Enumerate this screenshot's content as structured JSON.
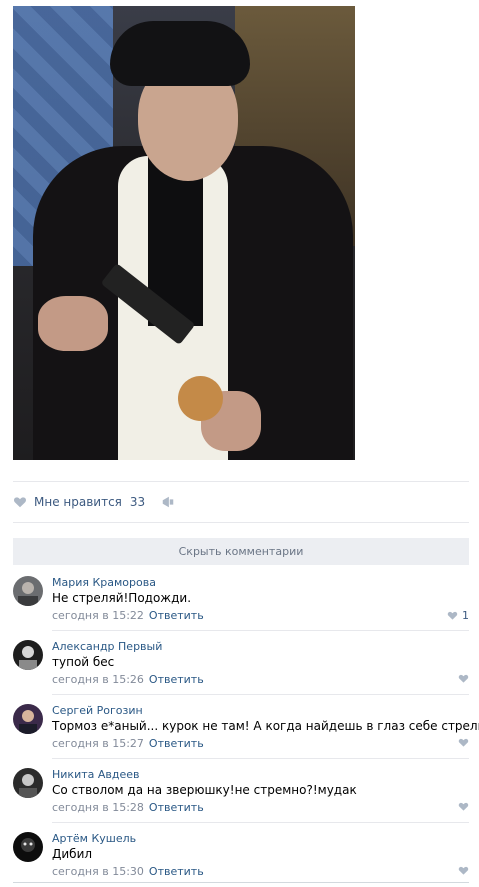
{
  "post": {
    "likes_label": "Мне нравится",
    "likes_count": "33",
    "hide_comments_label": "Скрыть комментарии"
  },
  "colors": {
    "link": "#2a5885",
    "muted": "#828a99",
    "like_icon": "#adb8c6"
  },
  "comments": [
    {
      "author": "Мария Краморова",
      "text": "Не стреляй!Подожди.",
      "time": "сегодня в 15:22",
      "reply": "Ответить",
      "likes": "1"
    },
    {
      "author": "Александр Первый",
      "text": "тупой бес",
      "time": "сегодня в 15:26",
      "reply": "Ответить",
      "likes": ""
    },
    {
      "author": "Сергей Рогозин",
      "text": "Тормоз е*аный... курок не там! А когда найдешь в глаз себе стрельни",
      "time": "сегодня в 15:27",
      "reply": "Ответить",
      "likes": ""
    },
    {
      "author": "Никита Авдеев",
      "text": "Со стволом да на зверюшку!не стремно?!мудак",
      "time": "сегодня в 15:28",
      "reply": "Ответить",
      "likes": ""
    },
    {
      "author": "Артём Кушель",
      "text": "Дибил",
      "time": "сегодня в 15:30",
      "reply": "Ответить",
      "likes": ""
    }
  ]
}
